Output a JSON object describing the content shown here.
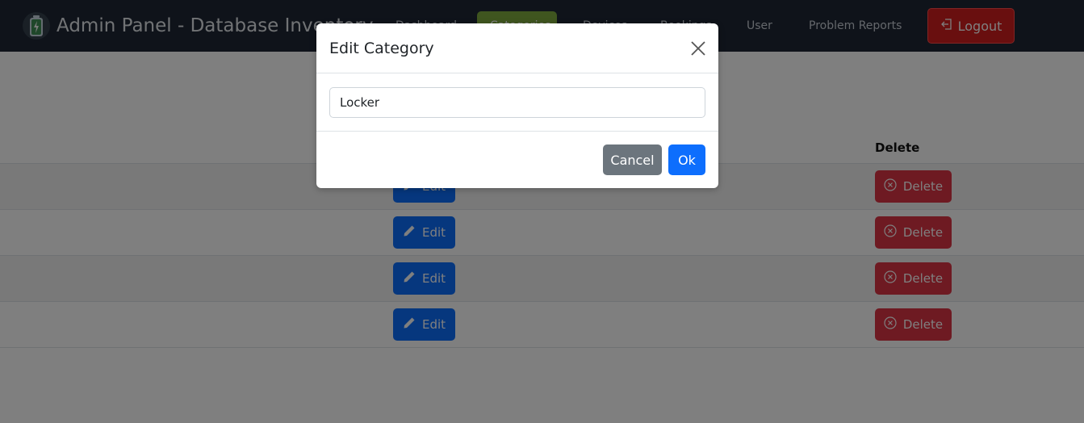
{
  "app": {
    "title": "Admin Panel - Database Inventory"
  },
  "nav": {
    "links": [
      "Dashboard",
      "Categories",
      "Devices",
      "Bookings",
      "User",
      "Problem Reports"
    ],
    "active_index": 1,
    "logout_label": "Logout"
  },
  "table": {
    "delete_header": "Delete",
    "edit_label": "Edit",
    "delete_label": "Delete",
    "row_count": 4
  },
  "modal": {
    "title": "Edit Category",
    "input_value": "Locker",
    "cancel_label": "Cancel",
    "ok_label": "Ok"
  },
  "colors": {
    "navbar": "#1e2735",
    "active_nav": "#7fab3f",
    "logout": "#d21e1e",
    "primary": "#0d6efd",
    "danger": "#dc3545",
    "secondary": "#6c757d"
  },
  "icons": {
    "brand": "battery-bolt-icon",
    "logout": "logout-icon",
    "edit": "pencil-icon",
    "delete": "x-circle-icon",
    "close": "close-icon"
  }
}
